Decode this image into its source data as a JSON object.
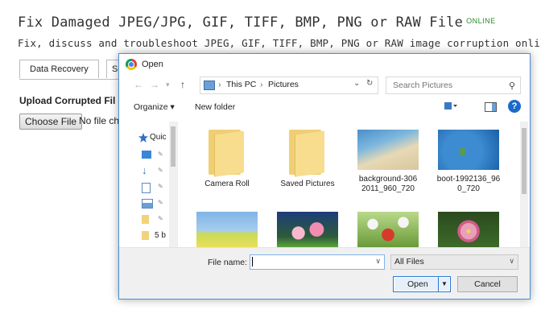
{
  "page": {
    "title": "Fix Damaged JPEG/JPG, GIF, TIFF, BMP, PNG or RAW File",
    "online_tag": "ONLINE",
    "subtitle": "Fix, discuss and troubleshoot JPEG, GIF, TIFF, BMP, PNG or RAW image corruption online",
    "tabs": [
      {
        "label": "Data Recovery"
      },
      {
        "label": "S"
      }
    ],
    "upload_heading": "Upload Corrupted Fil",
    "choose_button": "Choose File",
    "no_file_text": "No file ch"
  },
  "dialog": {
    "title": "Open",
    "path": [
      "This PC",
      "Pictures"
    ],
    "search_placeholder": "Search Pictures",
    "toolbar": {
      "organize": "Organize ▾",
      "new_folder": "New folder"
    },
    "nav_pane": [
      {
        "label": "Quic",
        "icon": "star-icon"
      },
      {
        "label": "",
        "icon": "desktop-icon"
      },
      {
        "label": "",
        "icon": "downloads-icon"
      },
      {
        "label": "",
        "icon": "documents-icon"
      },
      {
        "label": "",
        "icon": "pictures-icon"
      },
      {
        "label": "",
        "icon": "folder-icon"
      },
      {
        "label": "5 b",
        "icon": "folder-icon"
      }
    ],
    "files": [
      {
        "label": "Camera Roll",
        "type": "folder"
      },
      {
        "label": "Saved Pictures",
        "type": "folder"
      },
      {
        "label": "background-306\n2011_960_720",
        "type": "image",
        "palette": [
          "#4b8ec9",
          "#e7d9b5",
          "#3c9fbf"
        ]
      },
      {
        "label": "boot-1992136_96\n0_720",
        "type": "image",
        "palette": [
          "#1b5fa6",
          "#3d8bd1",
          "#5a9c4a"
        ]
      },
      {
        "label": "",
        "type": "image",
        "palette": [
          "#7fb4e6",
          "#c9d95a",
          "#e8e05a"
        ]
      },
      {
        "label": "",
        "type": "image",
        "palette": [
          "#1d3d7a",
          "#f28db2",
          "#5aa43a"
        ]
      },
      {
        "label": "",
        "type": "image",
        "palette": [
          "#b9d98a",
          "#d63a2a",
          "#f5f5f5"
        ]
      },
      {
        "label": "",
        "type": "image",
        "palette": [
          "#2a4a1e",
          "#e7a0b8",
          "#d45a8a"
        ]
      }
    ],
    "file_name_label": "File name:",
    "file_name_value": "",
    "file_type_filter": "All Files",
    "open_button": "Open",
    "cancel_button": "Cancel"
  }
}
